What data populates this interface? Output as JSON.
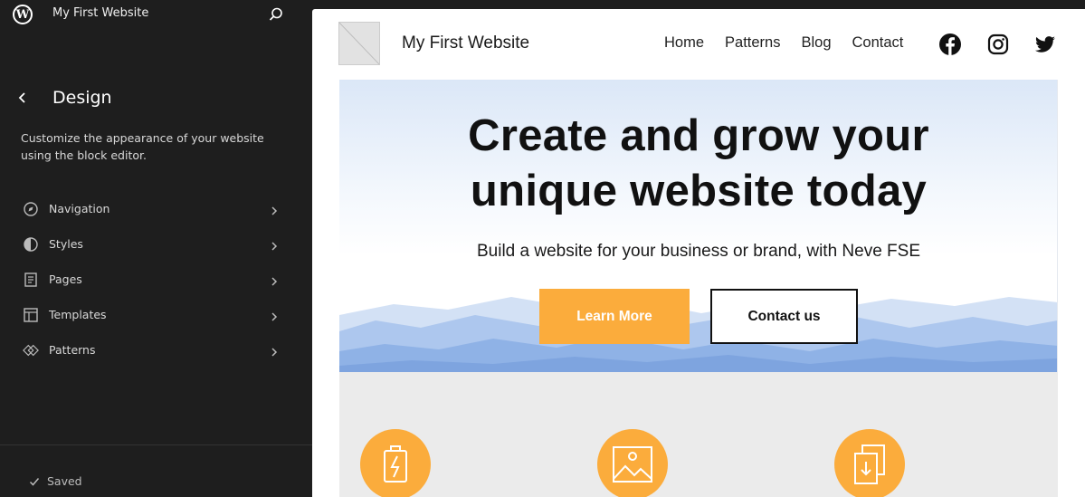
{
  "sidebar": {
    "logo_icon": "wordpress-icon",
    "site_name": "My First Website",
    "search_icon": "search-icon",
    "title": "Design",
    "description": "Customize the appearance of your website using the block editor.",
    "items": [
      {
        "label": "Navigation",
        "icon": "navigation-icon"
      },
      {
        "label": "Styles",
        "icon": "styles-icon"
      },
      {
        "label": "Pages",
        "icon": "pages-icon"
      },
      {
        "label": "Templates",
        "icon": "templates-icon"
      },
      {
        "label": "Patterns",
        "icon": "patterns-icon"
      }
    ],
    "status": "Saved"
  },
  "preview": {
    "site_title": "My First Website",
    "nav": [
      "Home",
      "Patterns",
      "Blog",
      "Contact"
    ],
    "social": [
      "facebook-icon",
      "instagram-icon",
      "twitter-icon"
    ],
    "hero": {
      "title_line1": "Create and grow your",
      "title_line2": "unique website today",
      "subtitle": "Build a website for your business or brand, with Neve FSE",
      "primary_button": "Learn More",
      "secondary_button": "Contact us"
    },
    "features": [
      "battery-icon",
      "image-icon",
      "document-download-icon"
    ]
  },
  "colors": {
    "sidebar_bg": "#1e1e1e",
    "accent": "#fbac3c",
    "hero_text": "#111111",
    "features_bg": "#ebebeb"
  }
}
